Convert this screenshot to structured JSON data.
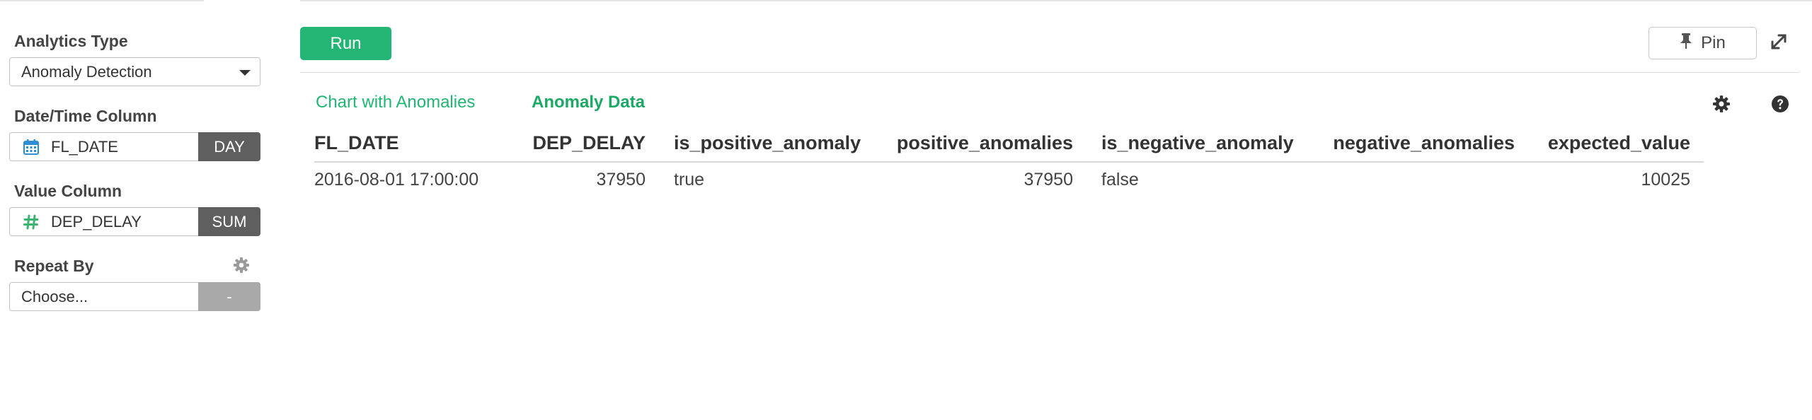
{
  "sidebar": {
    "analytics_type": {
      "label": "Analytics Type",
      "value": "Anomaly Detection"
    },
    "datetime_column": {
      "label": "Date/Time Column",
      "value": "FL_DATE",
      "icon": "calendar-icon",
      "addon": "DAY"
    },
    "value_column": {
      "label": "Value Column",
      "value": "DEP_DELAY",
      "icon": "hash-icon",
      "addon": "SUM"
    },
    "repeat_by": {
      "label": "Repeat By",
      "value": "Choose...",
      "addon": "-"
    }
  },
  "toolbar": {
    "run_label": "Run",
    "pin_label": "Pin"
  },
  "tabs": [
    {
      "label": "Chart with Anomalies",
      "active": false
    },
    {
      "label": "Anomaly Data",
      "active": true
    }
  ],
  "table": {
    "columns": [
      "FL_DATE",
      "DEP_DELAY",
      "is_positive_anomaly",
      "positive_anomalies",
      "is_negative_anomaly",
      "negative_anomalies",
      "expected_value"
    ],
    "rows": [
      [
        "2016-08-01 17:00:00",
        "37950",
        "true",
        "37950",
        "false",
        "",
        "10025"
      ]
    ]
  },
  "colors": {
    "accent": "#22b573",
    "addon_dark": "#5f5f5f",
    "addon_disabled": "#a9a9a9",
    "hash_icon": "#3cb371",
    "calendar_icon": "#2f8fd6"
  }
}
